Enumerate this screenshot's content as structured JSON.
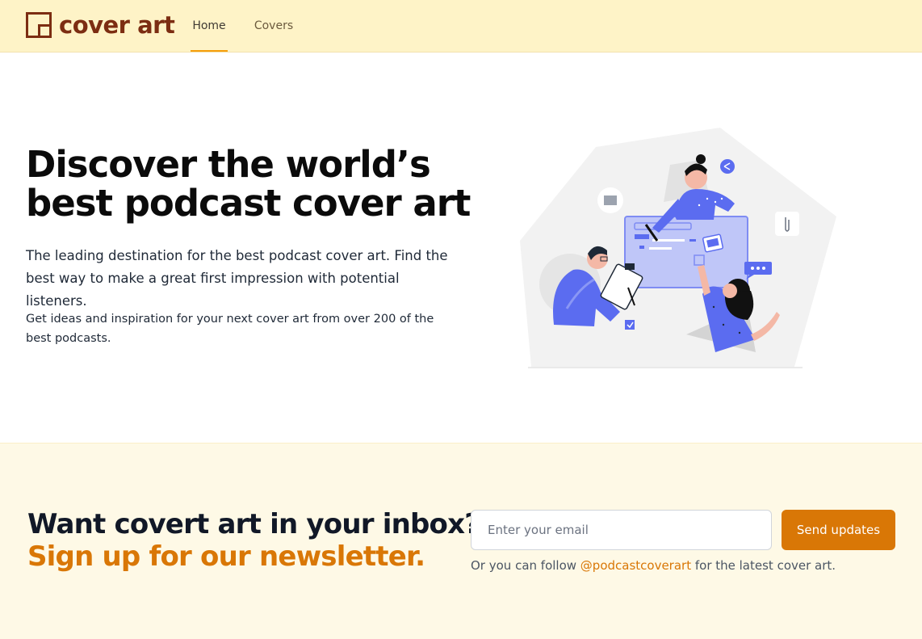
{
  "header": {
    "logo_text": "cover art",
    "nav": [
      {
        "label": "Home",
        "active": true
      },
      {
        "label": "Covers",
        "active": false
      }
    ]
  },
  "hero": {
    "title_line1": "Discover the world’s",
    "title_line2": "best podcast cover art",
    "lead": "The leading destination for the best podcast cover art. Find the best way to make a great first impression with potential listeners.",
    "sub": "Get ideas and inspiration for your next cover art from over 200 of the best podcasts."
  },
  "newsletter": {
    "heading_line1": "Want covert art in your inbox?",
    "heading_line2": "Sign up for our newsletter.",
    "email_placeholder": "Enter your email",
    "email_value": "",
    "button_label": "Send updates",
    "follow_prefix": "Or you can follow ",
    "follow_handle": "@podcastcoverart",
    "follow_suffix": " for the latest cover art."
  },
  "colors": {
    "header_bg": "#fef3c7",
    "brand": "#7c2d12",
    "accent": "#d97706",
    "newsletter_bg": "#fef9e6",
    "illustration_primary": "#5b6cf0"
  }
}
